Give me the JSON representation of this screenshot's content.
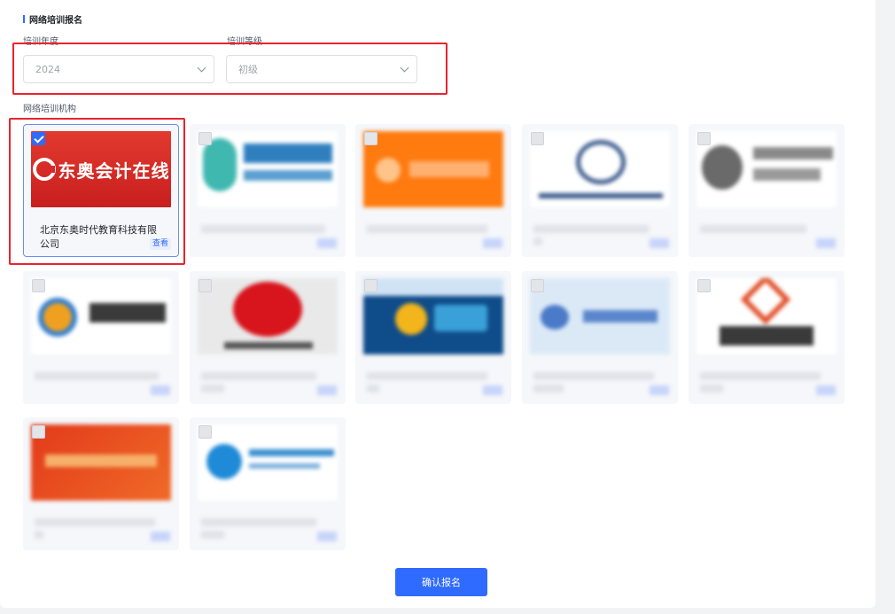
{
  "section_title": "网络培训报名",
  "filters": {
    "year_label": "培训年度",
    "year_value": "2024",
    "level_label": "培训等级",
    "level_value": "初级"
  },
  "institutions_label": "网络培训机构",
  "cards": [
    {
      "name": "北京东奥时代教育科技有限公司",
      "logo_text": "东奥会计在线",
      "view_label": "查看",
      "selected": true
    }
  ],
  "confirm_label": "确认报名",
  "colors": {
    "accent": "#2f6bff",
    "highlight": "#e8242e",
    "dongao_red": "#d9292b"
  }
}
